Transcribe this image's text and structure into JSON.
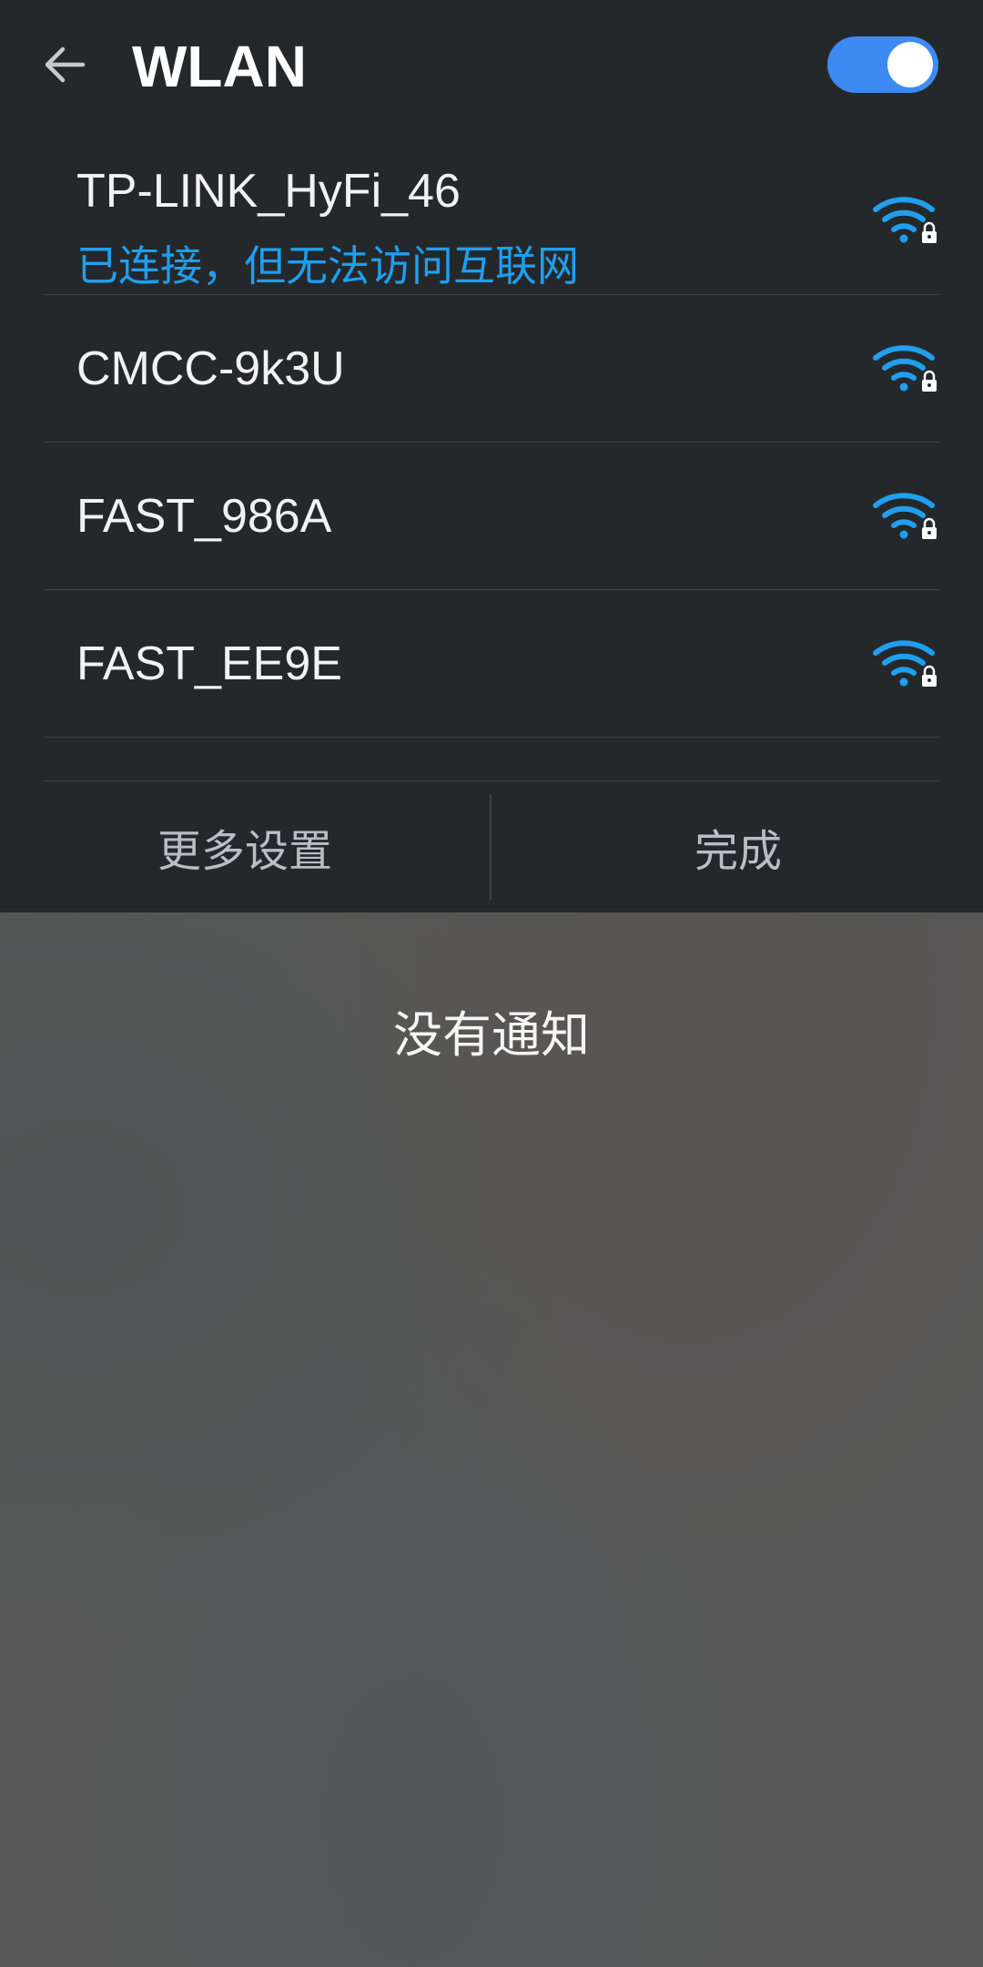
{
  "header": {
    "title": "WLAN",
    "back_icon": "arrow-left-icon",
    "toggle_on": true,
    "toggle_color": "#3d8bf2"
  },
  "networks": [
    {
      "ssid": "TP-LINK_HyFi_46",
      "status": "已连接，但无法访问互联网",
      "icon": "wifi-lock-icon"
    },
    {
      "ssid": "CMCC-9k3U",
      "icon": "wifi-lock-icon"
    },
    {
      "ssid": "FAST_986A",
      "icon": "wifi-lock-icon"
    },
    {
      "ssid": "FAST_EE9E",
      "icon": "wifi-lock-icon"
    }
  ],
  "actions": {
    "more_settings": "更多设置",
    "done": "完成"
  },
  "notifications": {
    "empty_text": "没有通知"
  },
  "colors": {
    "panel_bg": "#25282b",
    "accent": "#1f9fee",
    "shade_bg": "#585858"
  }
}
